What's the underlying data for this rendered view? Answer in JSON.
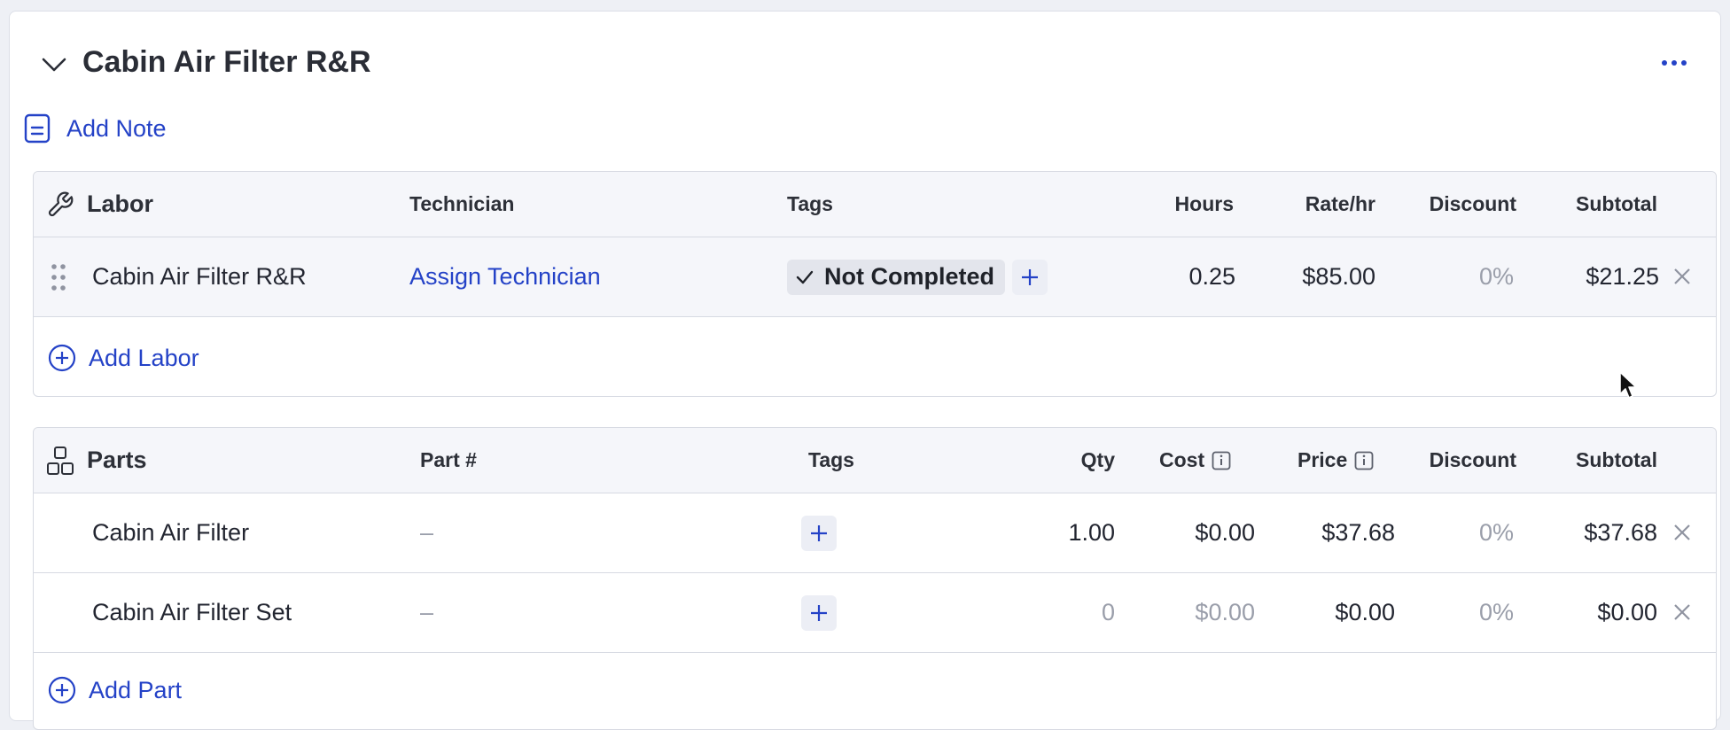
{
  "service": {
    "title": "Cabin Air Filter R&R",
    "add_note_label": "Add Note"
  },
  "labor": {
    "section_label": "Labor",
    "columns": {
      "technician": "Technician",
      "tags": "Tags",
      "hours": "Hours",
      "rate": "Rate/hr",
      "discount": "Discount",
      "subtotal": "Subtotal"
    },
    "rows": [
      {
        "name": "Cabin Air Filter R&R",
        "technician": "Assign Technician",
        "tag": "Not Completed",
        "hours": "0.25",
        "rate": "$85.00",
        "discount": "0%",
        "subtotal": "$21.25"
      }
    ],
    "add_label": "Add Labor"
  },
  "parts": {
    "section_label": "Parts",
    "columns": {
      "part_number": "Part #",
      "tags": "Tags",
      "qty": "Qty",
      "cost": "Cost",
      "price": "Price",
      "discount": "Discount",
      "subtotal": "Subtotal"
    },
    "rows": [
      {
        "name": "Cabin Air Filter",
        "part_number": "–",
        "qty": "1.00",
        "cost": "$0.00",
        "price": "$37.68",
        "discount": "0%",
        "subtotal": "$37.68"
      },
      {
        "name": "Cabin Air Filter Set",
        "part_number": "–",
        "qty": "0",
        "cost": "$0.00",
        "price": "$0.00",
        "discount": "0%",
        "subtotal": "$0.00"
      }
    ],
    "add_label": "Add Part"
  },
  "colors": {
    "accent": "#2442c7",
    "muted": "#9a9eaa",
    "header_bg": "#f5f6fa",
    "tag_bg": "#e3e5ec"
  },
  "icons": [
    "chevron-down-icon",
    "more-horizontal-icon",
    "note-icon",
    "wrench-icon",
    "drag-handle-icon",
    "check-icon",
    "plus-icon",
    "close-icon",
    "plus-circle-icon",
    "parts-icon",
    "info-icon",
    "cursor-icon"
  ]
}
